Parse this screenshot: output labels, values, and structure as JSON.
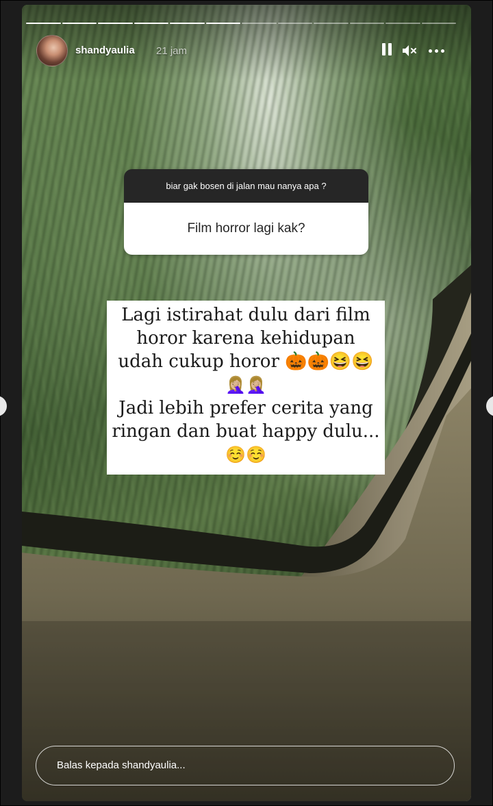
{
  "story": {
    "username": "shandyaulia",
    "timestamp": "21 jam",
    "progress_segments_total": 12,
    "progress_segments_done": 6
  },
  "icons": {
    "pause": "pause-icon",
    "mute": "mute-icon",
    "more": "more-icon",
    "prev": "chevron-left-icon",
    "next": "chevron-right-icon"
  },
  "question": {
    "prompt": "biar gak bosen di jalan mau nanya apa ?",
    "text": "Film horror lagi kak?"
  },
  "answer": {
    "line1": "Lagi istirahat dulu dari film",
    "line2": "horor karena kehidupan",
    "line3": "udah cukup horor 🎃🎃😆😆",
    "line4": "🤦🏼‍♀️🤦🏼‍♀️",
    "line5": "Jadi lebih prefer cerita yang",
    "line6": "ringan dan buat happy dulu...",
    "line7": "☺️☺️"
  },
  "reply": {
    "placeholder": "Balas kepada shandyaulia..."
  },
  "colors": {
    "question_header_bg": "#262626",
    "question_body_bg": "#ffffff",
    "answer_bg": "#ffffff"
  }
}
